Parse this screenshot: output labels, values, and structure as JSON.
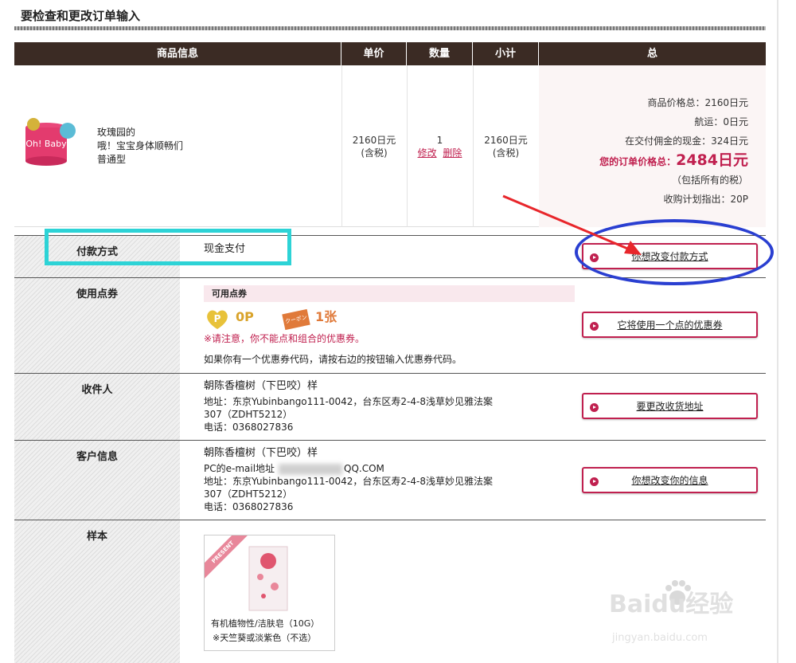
{
  "page_title": "要检查和更改订单输入",
  "table_headers": {
    "product_info": "商品信息",
    "unit_price": "单价",
    "quantity": "数量",
    "subtotal": "小计",
    "total": "总"
  },
  "product": {
    "name_line1": "玫瑰园的",
    "name_line2": "哦！宝宝身体顺畅们",
    "name_line3": "普通型",
    "image_text": "Oh! Baby",
    "unit_price": "2160日元",
    "unit_price_note": "(含税)",
    "quantity": "1",
    "edit_link": "修改",
    "delete_link": "删除",
    "subtotal": "2160日元",
    "subtotal_note": "(含税)"
  },
  "totals": {
    "goods_total": "商品价格总：2160日元",
    "shipping": "航运：0日元",
    "cod_fee": "在交付佣金的现金：324日元",
    "order_total_label": "您的订单价格总：",
    "order_total_value": "2484日元",
    "tax_note": "（包括所有的税）",
    "points_note": "收购计划指出：20P"
  },
  "payment": {
    "label": "付款方式",
    "value": "现金支付",
    "button": "你想改变付款方式"
  },
  "points": {
    "label": "使用点券",
    "banner": "可用点券",
    "points_value": "0P",
    "coupon_value": "1张",
    "coupon_tag": "クーポン",
    "warning": "※请注意，你不能点和组合的优惠券。",
    "info": "如果你有一个优惠券代码，请按右边的按钮输入优惠券代码。",
    "button": "它将使用一个点的优惠券"
  },
  "recipient": {
    "label": "收件人",
    "name": "朝陈香檀树（下巴咬）样",
    "address_line1": "地址：东京Yubinbango111-0042，台东区寿2-4-8浅草妙见雅法案",
    "address_line2": "307（ZDHT5212）",
    "phone": "电话：0368027836",
    "button": "要更改收货地址"
  },
  "customer": {
    "label": "客户信息",
    "name": "朝陈香檀树（下巴咬）样",
    "email_prefix": "PC的e-mail地址",
    "email_suffix": "QQ.COM",
    "address_line1": "地址：东京Yubinbango111-0042，台东区寿2-4-8浅草妙见雅法案",
    "address_line2": "307（ZDHT5212）",
    "phone": "电话：0368027836",
    "button": "你想改变你的信息"
  },
  "sample": {
    "label": "样本",
    "present_tag": "PRESENT",
    "name_line1": "有机植物性/洁肤皂（10G）",
    "name_line2": "※天竺葵或淡紫色（不选）"
  },
  "watermark": {
    "brand": "Baidu经验",
    "url": "jingyan.baidu.com"
  },
  "colors": {
    "header_bg": "#3b2b24",
    "accent": "#c0204f",
    "annotation_cyan": "#2dd3d6",
    "annotation_blue": "#2a3fd1",
    "annotation_arrow": "#e8262b"
  }
}
